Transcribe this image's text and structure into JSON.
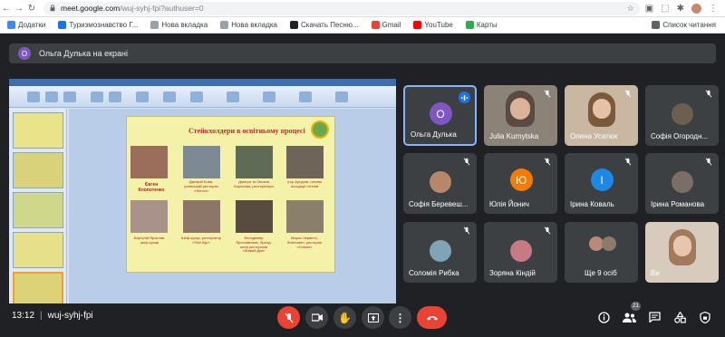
{
  "browser": {
    "url_main": "meet.google.com",
    "url_path": "/wuj-syhj-fpi?authuser=0"
  },
  "bookmarks": {
    "items": [
      {
        "label": "Додатки",
        "color": "#4285f4"
      },
      {
        "label": "Туризмознавство Г...",
        "color": "#1a73e8"
      },
      {
        "label": "Нова вкладка",
        "color": "#9aa0a6"
      },
      {
        "label": "Нова вкладка",
        "color": "#9aa0a6"
      },
      {
        "label": "Скачать Песню...",
        "color": "#202124"
      },
      {
        "label": "Gmail",
        "color": "#ea4335"
      },
      {
        "label": "YouTube",
        "color": "#ff0000"
      },
      {
        "label": "Карты",
        "color": "#34a853"
      }
    ],
    "reading_list": "Список читання"
  },
  "banner": {
    "avatar_letter": "О",
    "text": "Ольга Дулька на екрані"
  },
  "slide": {
    "title": "Стейкхолдери в освітньому процесі",
    "caption_left": "Євген Клопотенко",
    "captions": [
      "Дмитрій Бова, учнівський ресторан «Жіточі»",
      "Дмитро та Оксана Борисови, ресторатори",
      "Ігор Аргуров, голова асоціації готелів",
      "Бартулій Ярослав, шеф-кухар",
      "Шеф-кухар, ресторатор «Пан Кур»",
      "Володимир Ярославович, бренд-шеф ресторанів «Живий Дім»",
      "Марко Черветті, бізнесмен, ресторан «Сільпо»"
    ]
  },
  "participants": [
    {
      "name": "Ольга Дулька",
      "letter": "О",
      "color": "#7e57c2",
      "type": "letter",
      "speaking": true
    },
    {
      "name": "Julia Kurnytska",
      "type": "video",
      "video_bg": "#8b8278"
    },
    {
      "name": "Олена Усатюк",
      "type": "video",
      "video_bg": "#c9b7a1"
    },
    {
      "name": "Софія Огородн...",
      "type": "photo",
      "color": "#6d5f4e"
    },
    {
      "name": "Софія Беревеш...",
      "type": "photo",
      "color": "#b8876a"
    },
    {
      "name": "Юлія Йонич",
      "letter": "Ю",
      "color": "#f57c00",
      "type": "letter"
    },
    {
      "name": "Ірина Коваль",
      "letter": "І",
      "color": "#1e88e5",
      "type": "letter"
    },
    {
      "name": "Ірина Романова",
      "type": "photo",
      "color": "#7a6e66"
    },
    {
      "name": "Соломія Рибка",
      "type": "photo",
      "color": "#7fa4b8"
    },
    {
      "name": "Зоряна Кіндій",
      "type": "photo",
      "color": "#c77a83"
    },
    {
      "name": "Ще 9 осіб",
      "type": "more"
    },
    {
      "name": "Ви",
      "type": "video",
      "video_bg": "#d7cbbd"
    }
  ],
  "bottom": {
    "time": "13:12",
    "meeting_code": "wuj-syhj-fpi",
    "people_count": "21"
  }
}
